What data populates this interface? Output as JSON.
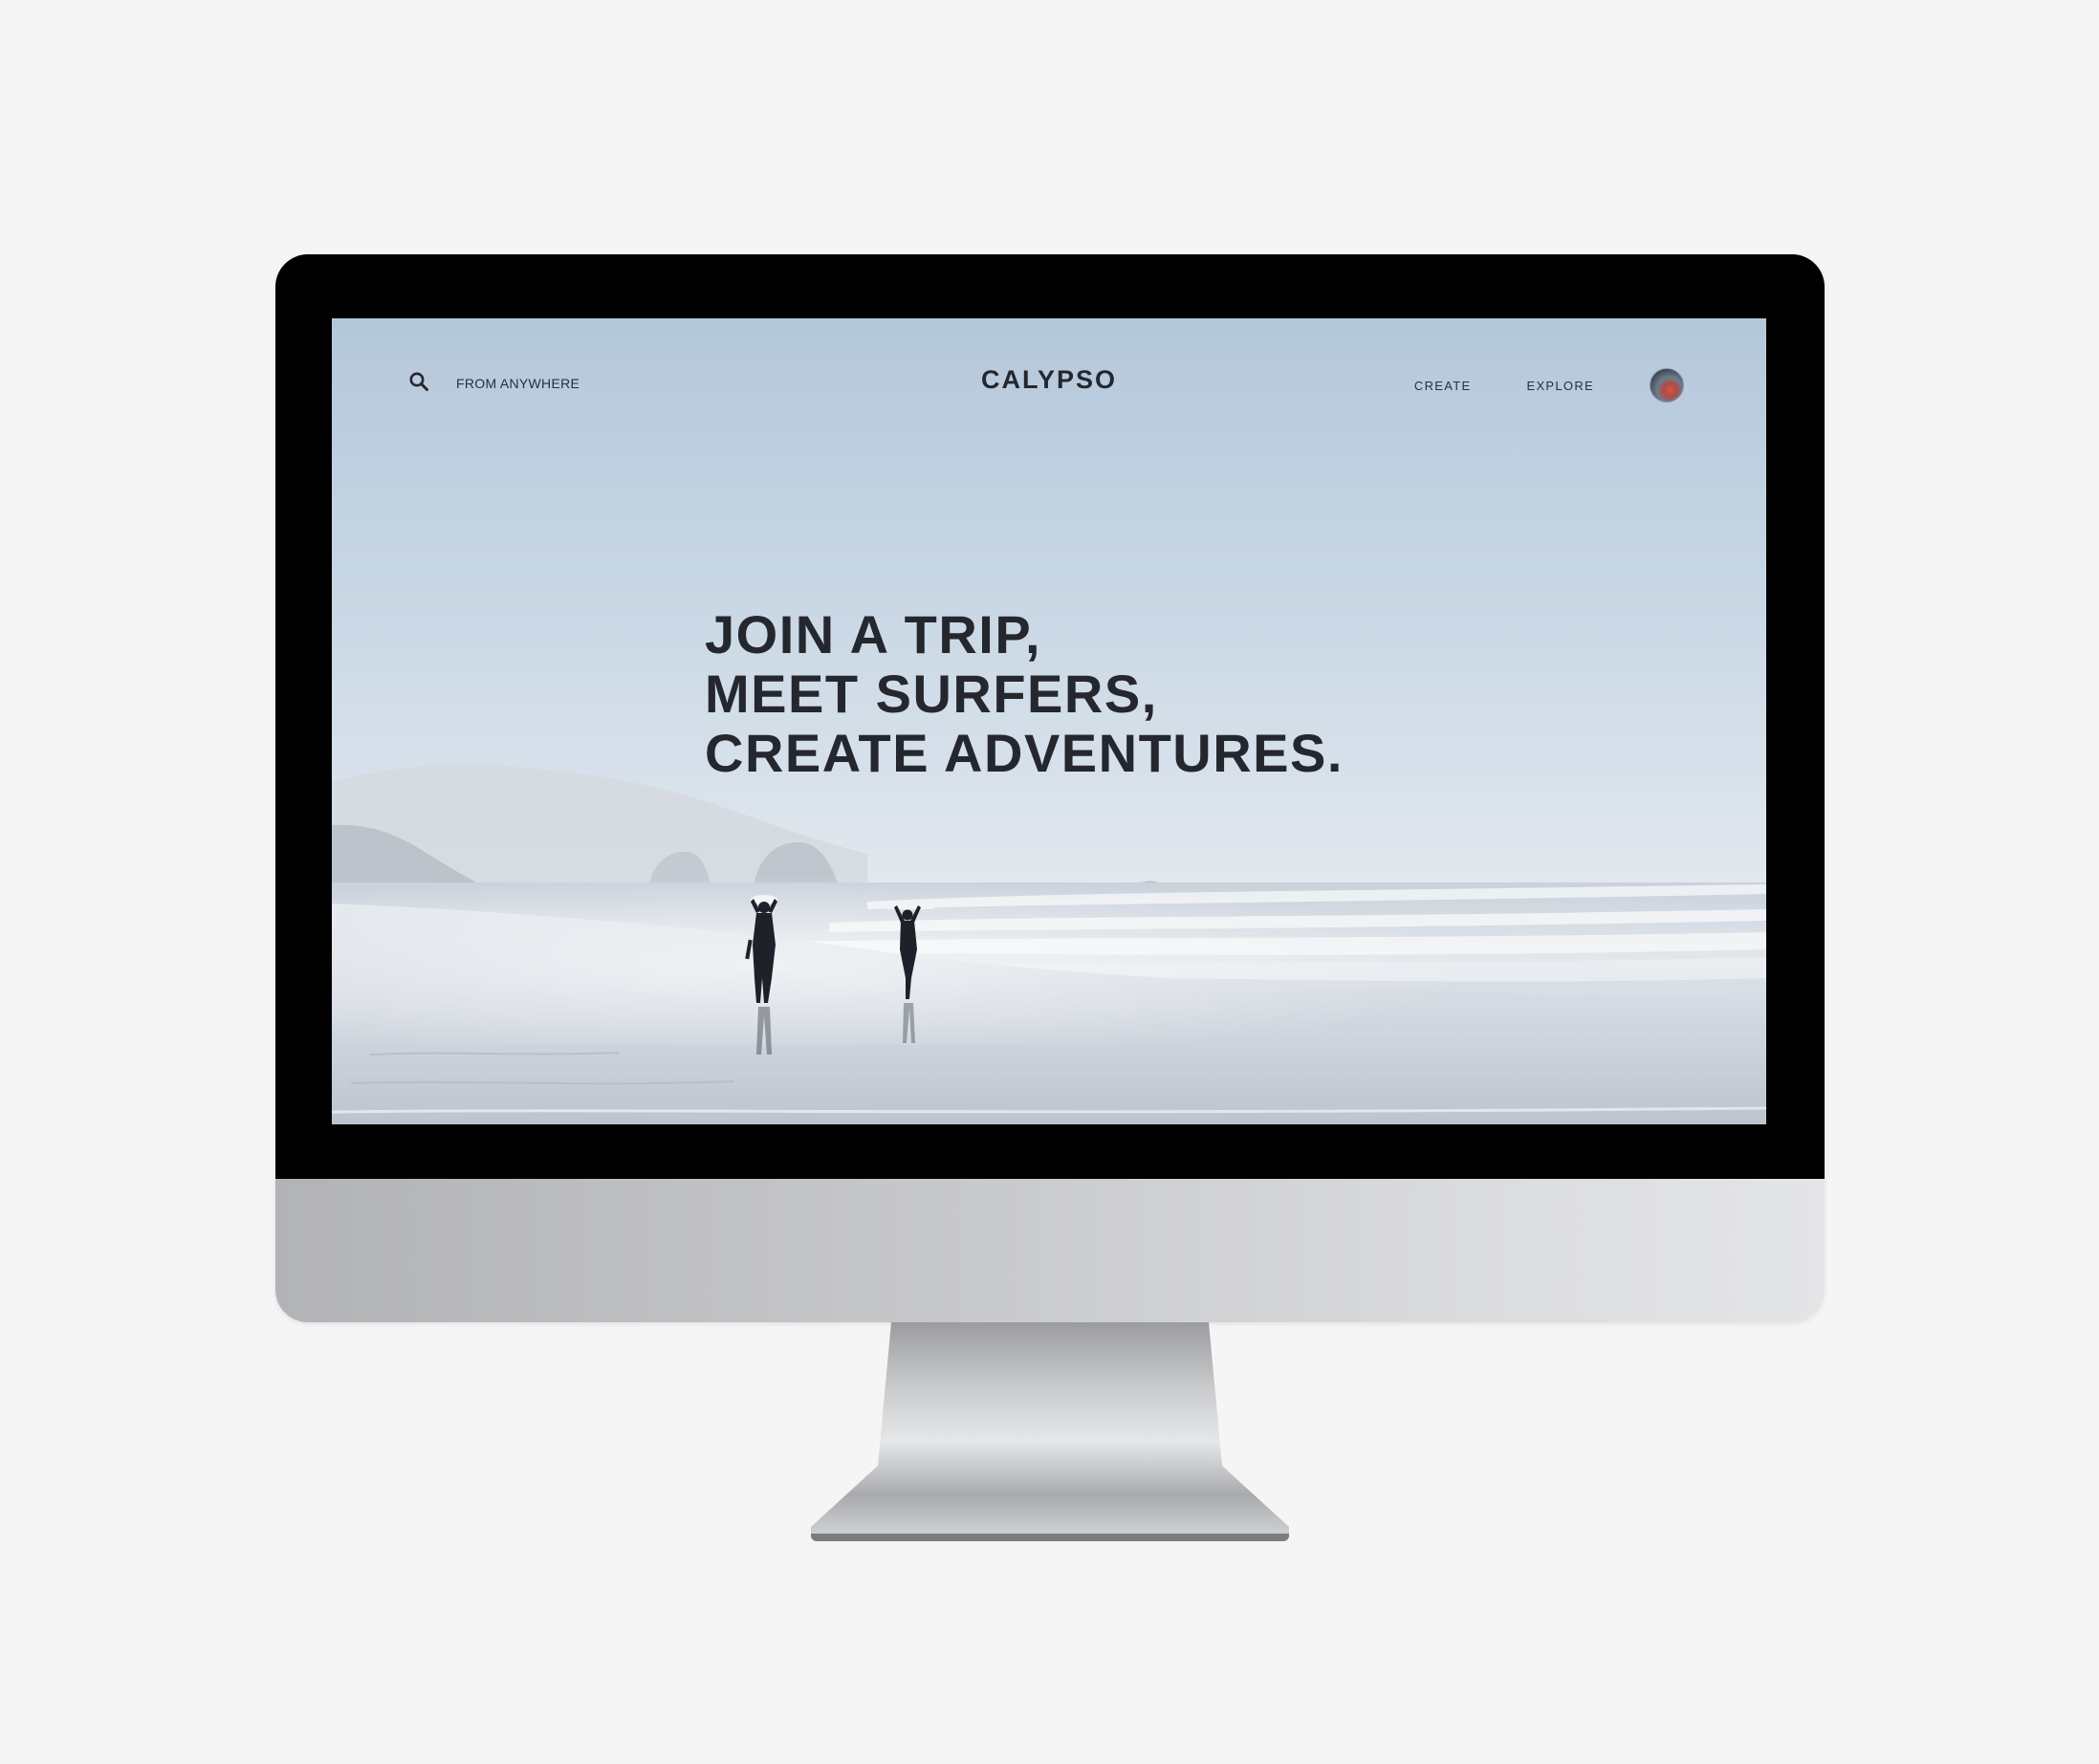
{
  "nav": {
    "search_label": "FROM ANYWHERE",
    "logo": "CALYPSO",
    "links": [
      {
        "label": "CREATE"
      },
      {
        "label": "EXPLORE"
      }
    ],
    "icons": {
      "search": "search-icon",
      "avatar": "avatar"
    }
  },
  "hero": {
    "lines": [
      "JOIN A TRIP,",
      "MEET SURFERS,",
      "CREATE ADVENTURES."
    ]
  },
  "colors": {
    "text_dark": "#25272f",
    "sky_top": "#b4c7da",
    "sea_foam": "#e2e8ee",
    "bezel": "#000000",
    "chin": "#c8c9cb",
    "page_background": "#f5f5f5"
  }
}
